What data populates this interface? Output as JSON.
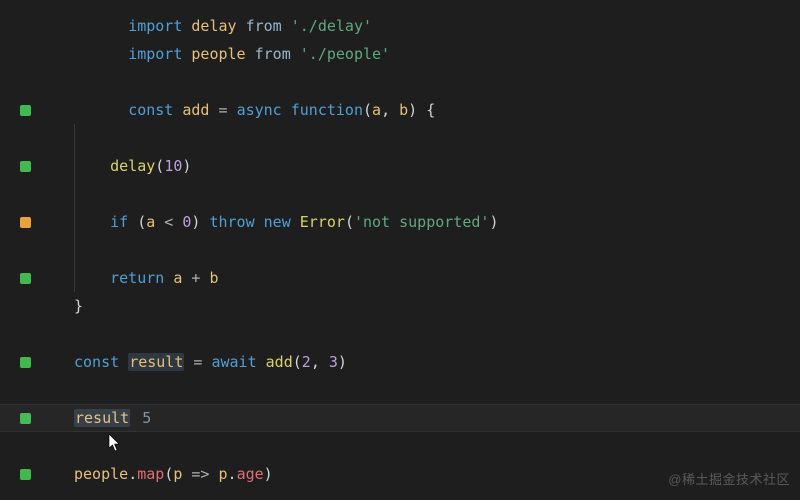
{
  "code": {
    "l1": {
      "import": "import",
      "id": "delay",
      "from": "from",
      "path": "'./delay'"
    },
    "l2": {
      "import": "import",
      "id": "people",
      "from": "from",
      "path": "'./people'"
    },
    "l4": {
      "const": "const",
      "name": "add",
      "eq": " = ",
      "async": "async",
      "function": "function",
      "params_open": "(",
      "a": "a",
      "comma": ", ",
      "b": "b",
      "params_close": ") {"
    },
    "l6": {
      "indent": "    ",
      "call": "delay",
      "open": "(",
      "arg": "10",
      "close": ")"
    },
    "l8": {
      "indent": "    ",
      "if": "if",
      "po": " (",
      "a": "a",
      "op": " < ",
      "zero": "0",
      "pc": ") ",
      "throw": "throw",
      "sp": " ",
      "new": "new",
      "sp2": " ",
      "err": "Error",
      "eo": "(",
      "msg": "'not supported'",
      "ec": ")"
    },
    "l10": {
      "indent": "    ",
      "return": "return",
      "sp": " ",
      "a": "a",
      "op": " + ",
      "b": "b"
    },
    "l11": {
      "brace": "}"
    },
    "l13": {
      "const": "const",
      "sp": " ",
      "result": "result",
      "eq": " = ",
      "await": "await",
      "sp2": " ",
      "call": "add",
      "po": "(",
      "n1": "2",
      "c": ", ",
      "n2": "3",
      "pc": ")"
    },
    "l15": {
      "result": "result",
      "val": "5"
    },
    "l17": {
      "obj": "people",
      "dot": ".",
      "map": "map",
      "po": "(",
      "p": "p",
      "arrow": " => ",
      "p2": "p",
      "dot2": ".",
      "age": "age",
      "pc": ")"
    }
  },
  "gutter": {
    "l4": "green",
    "l6": "green",
    "l8": "yellow",
    "l10": "green",
    "l13": "green",
    "l15": "green",
    "l17": "green"
  },
  "watermark": "@稀土掘金技术社区"
}
